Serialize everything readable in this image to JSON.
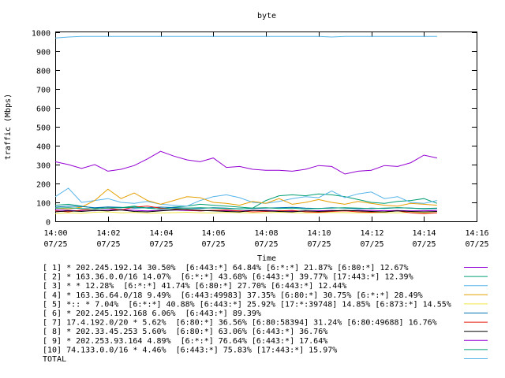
{
  "chart_data": {
    "type": "line",
    "title": "byte",
    "xlabel": "Time",
    "ylabel": "traffic (Mbps)",
    "ylim": [
      0,
      1000
    ],
    "yticks": [
      0,
      100,
      200,
      300,
      400,
      500,
      600,
      700,
      800,
      900,
      1000
    ],
    "xticks": [
      {
        "time": "14:00",
        "date": "07/25"
      },
      {
        "time": "14:02",
        "date": "07/25"
      },
      {
        "time": "14:04",
        "date": "07/25"
      },
      {
        "time": "14:06",
        "date": "07/25"
      },
      {
        "time": "14:08",
        "date": "07/25"
      },
      {
        "time": "14:10",
        "date": "07/25"
      },
      {
        "time": "14:12",
        "date": "07/25"
      },
      {
        "time": "14:14",
        "date": "07/25"
      },
      {
        "time": "14:16",
        "date": "07/25"
      }
    ],
    "x_minutes": [
      0,
      0.5,
      1,
      1.5,
      2,
      2.5,
      3,
      3.5,
      4,
      4.5,
      5,
      5.5,
      6,
      6.5,
      7,
      7.5,
      8,
      8.5,
      9,
      9.5,
      10,
      10.5,
      11,
      11.5,
      12,
      12.5,
      13,
      13.5,
      14,
      14.5
    ],
    "grid": false,
    "legend_position": "bottom",
    "series": [
      {
        "name": "[ 1] * 202.245.192.14 30.50%  [6:443:*] 64.84% [6:*:*] 21.87% [6:80:*] 12.67%",
        "color": "#9400d3",
        "values": [
          60,
          58,
          55,
          56,
          60,
          62,
          58,
          55,
          58,
          60,
          57,
          55,
          58,
          56,
          55,
          57,
          58,
          56,
          54,
          55,
          56,
          58,
          55,
          57,
          58,
          56,
          57,
          55,
          56,
          57
        ]
      },
      {
        "name": "[ 2] * 163.36.0.0/16 14.07%  [6:*:*] 43.68% [6:443:*] 39.77% [17:443:*] 12.39%",
        "color": "#009e73",
        "values": [
          85,
          90,
          80,
          70,
          75,
          72,
          80,
          70,
          65,
          75,
          80,
          90,
          85,
          80,
          75,
          70,
          110,
          135,
          140,
          135,
          145,
          140,
          130,
          115,
          100,
          95,
          105,
          110,
          120,
          95
        ]
      },
      {
        "name": "[ 3] * * 12.28%  [6:*:*] 41.74% [6:80:*] 27.70% [6:443:*] 12.44%",
        "color": "#56b4e9",
        "values": [
          130,
          175,
          100,
          110,
          120,
          100,
          95,
          105,
          90,
          85,
          80,
          110,
          130,
          140,
          125,
          100,
          95,
          105,
          120,
          130,
          125,
          160,
          125,
          145,
          155,
          120,
          130,
          100,
          95,
          110
        ]
      },
      {
        "name": "[ 4] * 163.36.64.0/18 9.49%  [6:443:49983] 37.35% [6:80:*] 30.75% [6:*:*] 28.49%",
        "color": "#e69f00",
        "values": [
          70,
          65,
          75,
          110,
          170,
          120,
          150,
          110,
          90,
          110,
          130,
          125,
          100,
          95,
          85,
          105,
          95,
          120,
          90,
          100,
          115,
          100,
          90,
          105,
          95,
          85,
          80,
          95,
          90,
          85
        ]
      },
      {
        "name": "[ 5] *:: * 7.04%  [6:*:*] 40.88% [6:443:*] 25.92% [17:*:39748] 14.85% [6:873:*] 14.55%",
        "color": "#f0e442",
        "values": [
          40,
          45,
          42,
          48,
          50,
          45,
          47,
          43,
          44,
          46,
          48,
          45,
          44,
          47,
          46,
          44,
          45,
          48,
          46,
          44,
          45,
          47,
          46,
          45,
          44,
          46,
          45,
          47,
          46,
          45
        ]
      },
      {
        "name": "[ 6] * 202.245.192.168 6.06%  [6:443:*] 89.39%",
        "color": "#0072b2",
        "values": [
          75,
          80,
          78,
          72,
          76,
          74,
          70,
          72,
          75,
          73,
          70,
          68,
          72,
          70,
          66,
          68,
          70,
          72,
          74,
          70,
          68,
          72,
          70,
          66,
          70,
          68,
          72,
          70,
          66,
          68
        ]
      },
      {
        "name": "[ 7] 17.4.192.0/20 * 5.62%  [6:80:*] 36.56% [6:80:58394] 31.24% [6:80:49688] 16.76%",
        "color": "#e51e10",
        "values": [
          55,
          50,
          60,
          65,
          70,
          60,
          75,
          80,
          70,
          65,
          60,
          55,
          58,
          60,
          55,
          50,
          52,
          55,
          58,
          50,
          48,
          52,
          55,
          50,
          48,
          50,
          55,
          45,
          40,
          45
        ]
      },
      {
        "name": "[ 8] * 202.33.45.253 5.60%  [6:80:*] 63.06% [6:443:*] 36.76%",
        "color": "#000000",
        "values": [
          50,
          55,
          52,
          58,
          55,
          60,
          52,
          50,
          55,
          60,
          62,
          58,
          55,
          52,
          50,
          58,
          55,
          52,
          50,
          55,
          52,
          55,
          58,
          55,
          52,
          50,
          55,
          52,
          50,
          52
        ]
      },
      {
        "name": "[ 9] * 202.253.93.164 4.89%  [6:*:*] 76.64% [6:443:*] 17.64%",
        "color": "#9400d3",
        "values": [
          315,
          300,
          280,
          300,
          265,
          275,
          295,
          330,
          370,
          345,
          325,
          315,
          335,
          285,
          290,
          275,
          270,
          270,
          265,
          275,
          295,
          290,
          250,
          265,
          270,
          295,
          290,
          310,
          350,
          335
        ]
      },
      {
        "name": "[10] 74.133.0.0/16 * 4.46%  [6:443:*] 75.83% [17:443:*] 15.97%",
        "color": "#009e73",
        "values": [
          70,
          72,
          68,
          65,
          70,
          72,
          75,
          70,
          65,
          68,
          70,
          72,
          70,
          68,
          65,
          70,
          72,
          68,
          70,
          65,
          68,
          70,
          72,
          70,
          68,
          70,
          72,
          70,
          68,
          70
        ]
      },
      {
        "name": "TOTAL",
        "color": "#56b4e9",
        "values": [
          970,
          975,
          978,
          978,
          978,
          978,
          978,
          978,
          978,
          978,
          978,
          978,
          978,
          978,
          978,
          978,
          978,
          978,
          978,
          978,
          978,
          975,
          978,
          978,
          978,
          978,
          978,
          978,
          978,
          978
        ]
      }
    ]
  }
}
